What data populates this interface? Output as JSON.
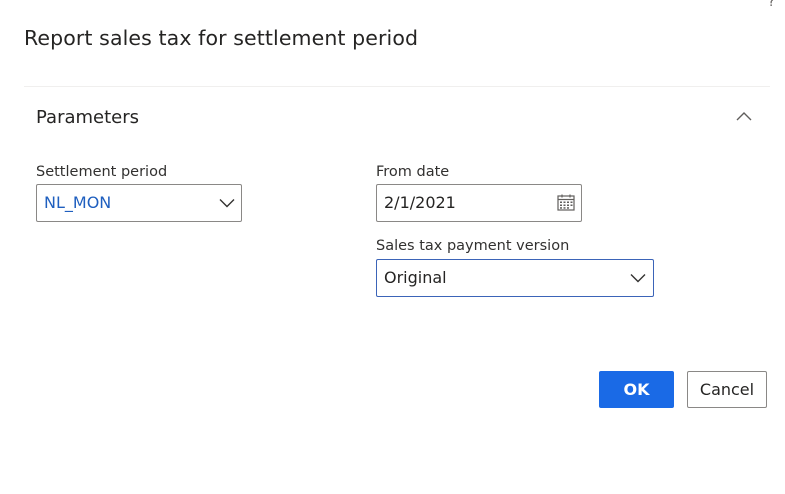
{
  "dialog": {
    "help_glyph": "?",
    "title": "Report sales tax for settlement period"
  },
  "parameters": {
    "section_title": "Parameters",
    "settlement_period": {
      "label": "Settlement period",
      "value": "NL_MON"
    },
    "from_date": {
      "label": "From date",
      "value": "2/1/2021"
    },
    "payment_version": {
      "label": "Sales tax payment version",
      "value": "Original"
    }
  },
  "buttons": {
    "ok": "OK",
    "cancel": "Cancel"
  },
  "colors": {
    "primary": "#1a6ae6",
    "link_value": "#1f5fbf",
    "focus_border": "#3b64b8",
    "border": "#8a8886"
  },
  "icons": {
    "help": "question-icon",
    "collapse": "chevron-up-icon",
    "dropdown": "chevron-down-icon",
    "calendar": "calendar-icon"
  }
}
